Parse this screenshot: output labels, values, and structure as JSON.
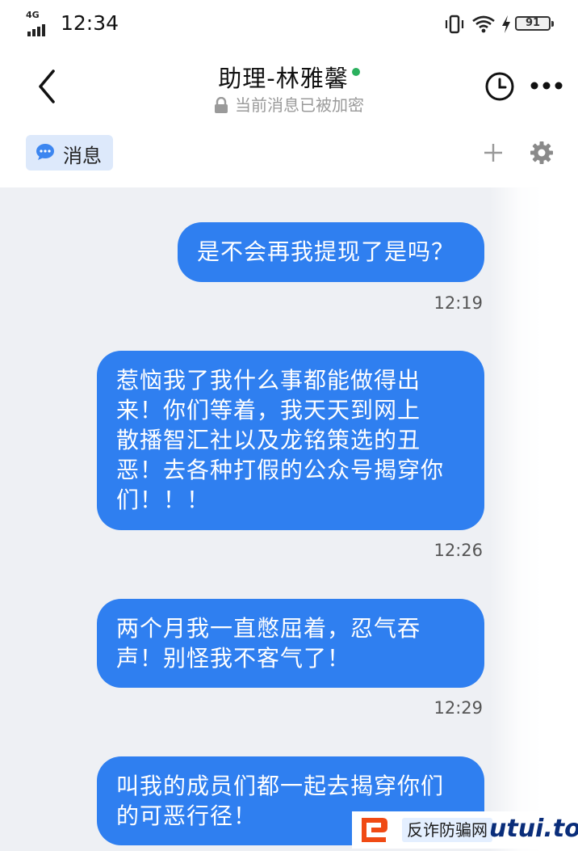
{
  "status_bar": {
    "network": "4G",
    "time": "12:34",
    "battery": "91",
    "icons": [
      "signal-icon",
      "vibrate-icon",
      "wifi-icon",
      "charging-icon",
      "battery-icon"
    ]
  },
  "header": {
    "title": "助理-林雅馨",
    "subtitle": "当前消息已被加密",
    "online_color": "#2bb05e"
  },
  "tabs": {
    "messages_label": "消息"
  },
  "messages": [
    {
      "text": "是不会再我提现了是吗？",
      "time": "12:19"
    },
    {
      "text": "惹恼我了我什么事都能做得出\n来！你们等着，我天天到网上\n散播智汇社以及龙铭策选的丑\n恶！去各种打假的公众号揭穿你\n们！！！",
      "time": "12:26"
    },
    {
      "text": "两个月我一直憋屈着，忍气吞\n声！别怪我不客气了！",
      "time": "12:29"
    },
    {
      "text": "叫我的成员们都一起去揭穿你们\n的可恶行径！",
      "time": ""
    }
  ],
  "watermark": {
    "cn": "反诈防骗网",
    "en": "utui.top"
  },
  "colors": {
    "bubble": "#2f7ff0",
    "chat_bg": "#eef0f4",
    "tab_active_bg": "#dde9fb"
  }
}
